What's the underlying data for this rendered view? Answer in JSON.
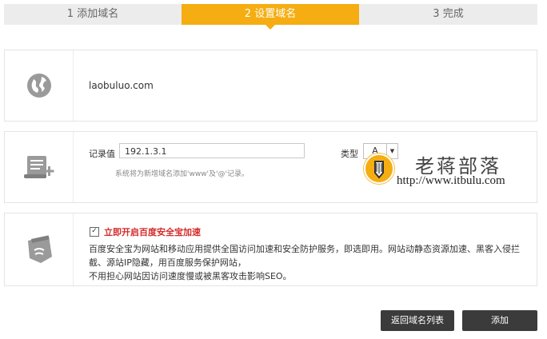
{
  "steps": [
    {
      "label": "1 添加域名",
      "active": false
    },
    {
      "label": "2 设置域名",
      "active": true
    },
    {
      "label": "3 完成",
      "active": false
    }
  ],
  "domain_panel": {
    "icon": "globe-icon",
    "domain": "laobuluo.com"
  },
  "record_panel": {
    "icon": "record-scroll-icon",
    "record_label": "记录值",
    "record_value": "192.1.3.1",
    "hint": "系统将为新增域名添加'www'及'@'记录。",
    "type_label": "类型",
    "type_value": "A"
  },
  "security_panel": {
    "icon": "shield-icon",
    "checked": true,
    "title": "立即开启百度安全宝加速",
    "desc_lines": [
      "百度安全宝为网站和移动应用提供全国访问加速和安全防护服务，即选即用。网站动静态资源加速、黑客入侵拦截、源站IP隐藏，用百度服务保护网站，",
      "不用担心网站因访问速度慢或被黑客攻击影响SEO。"
    ]
  },
  "watermark": {
    "title": "老蒋部落",
    "url": "http://www.itbulu.com"
  },
  "buttons": {
    "back": "返回域名列表",
    "add": "添加"
  },
  "colors": {
    "accent": "#f5ad12",
    "danger": "#d52b2b",
    "button": "#3b3b3b"
  }
}
